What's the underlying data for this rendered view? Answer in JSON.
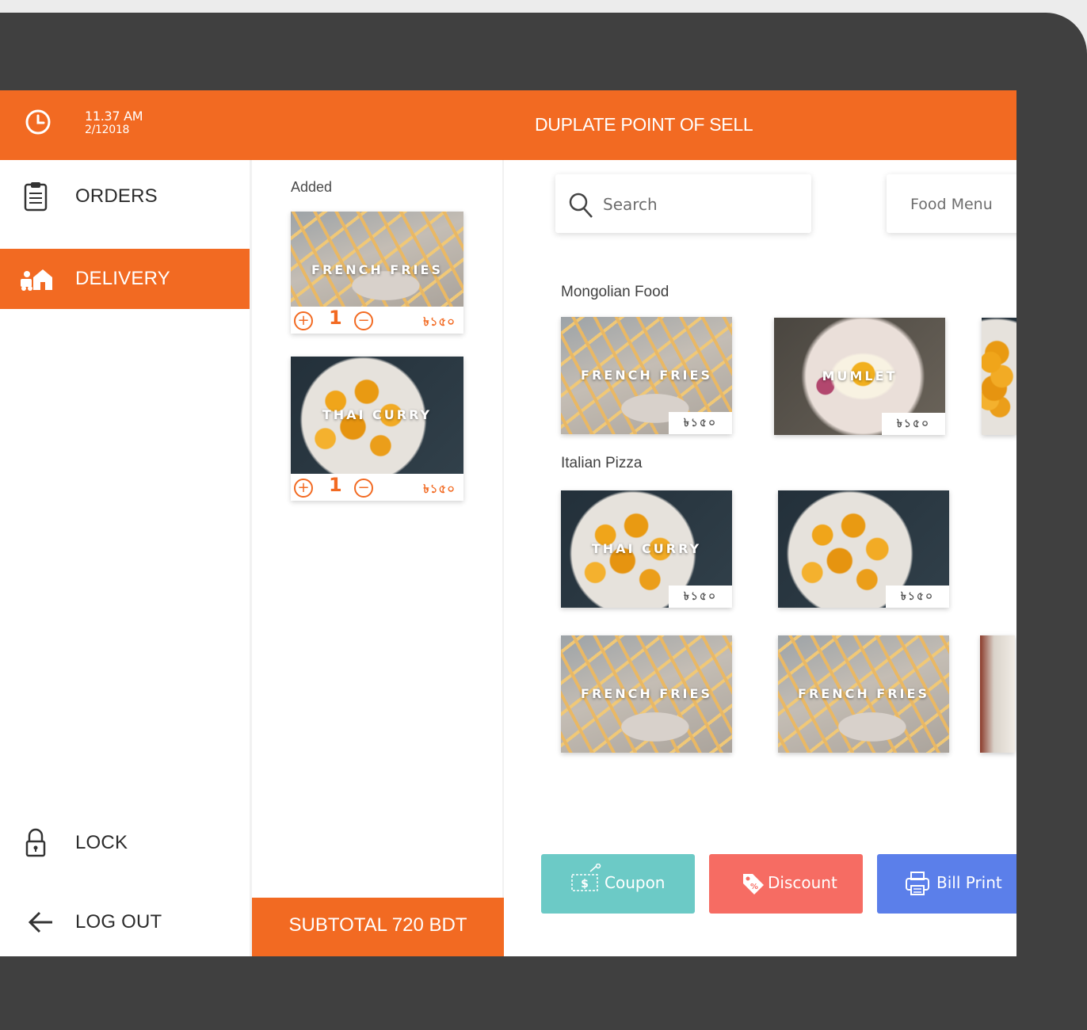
{
  "header": {
    "time": "11.37 AM",
    "date": "2/12018",
    "title": "DUPLATE POINT OF SELL",
    "clock_icon": "clock-icon"
  },
  "sidebar": {
    "items": [
      {
        "label": "ORDERS",
        "icon": "clipboard-icon",
        "active": false
      },
      {
        "label": "DELIVERY",
        "icon": "delivery-house-icon",
        "active": true
      },
      {
        "label": "LOCK",
        "icon": "lock-icon",
        "active": false
      },
      {
        "label": "LOG OUT",
        "icon": "arrow-left-icon",
        "active": false
      }
    ]
  },
  "cart": {
    "title": "Added",
    "items": [
      {
        "name": "FRENCH FRIES",
        "qty": "1",
        "price": "৳১৫০",
        "plus": "+",
        "minus": "−"
      },
      {
        "name": "THAI CURRY",
        "qty": "1",
        "price": "৳১৫০",
        "plus": "+",
        "minus": "−"
      }
    ],
    "subtotal": "SUBTOTAL 720 BDT"
  },
  "menu": {
    "search_placeholder": "Search",
    "category_dropdown": "Food Menu",
    "sections": [
      {
        "title": "Mongolian Food",
        "items": [
          {
            "name": "FRENCH FRIES",
            "price": "৳১৫০"
          },
          {
            "name": "MUMLET",
            "price": "৳১৫০"
          }
        ]
      },
      {
        "title": "Italian Pizza",
        "items": [
          {
            "name": "THAI CURRY",
            "price": "৳১৫০"
          },
          {
            "name": "",
            "price": "৳১৫০"
          },
          {
            "name": "FRENCH FRIES",
            "price": ""
          },
          {
            "name": "FRENCH FRIES",
            "price": ""
          }
        ]
      }
    ]
  },
  "actions": {
    "coupon": "Coupon",
    "discount": "Discount",
    "bill_print": "Bill Print"
  },
  "colors": {
    "accent": "#f26a22",
    "coupon": "#6ccac6",
    "discount": "#f66c63",
    "bill_print": "#5b7fea",
    "device_frame": "#404040"
  }
}
